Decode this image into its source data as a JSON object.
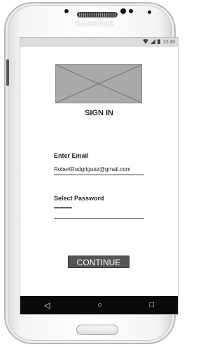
{
  "device": {
    "brand": "SAMSUNG"
  },
  "status_bar": {
    "time": "12:30",
    "wifi_icon": "wifi-icon",
    "signal_icon": "signal-icon",
    "battery_icon": "battery-icon"
  },
  "signin": {
    "title": "SIGN IN",
    "email_label": "Enter Email",
    "email_value": "RobertRodgriguez@gmail.com",
    "password_label": "Select Password",
    "password_value": "••••••••••••••••",
    "continue_label": "CONTINUE"
  },
  "nav": {
    "back": "◁",
    "home": "○",
    "recent": "□"
  }
}
